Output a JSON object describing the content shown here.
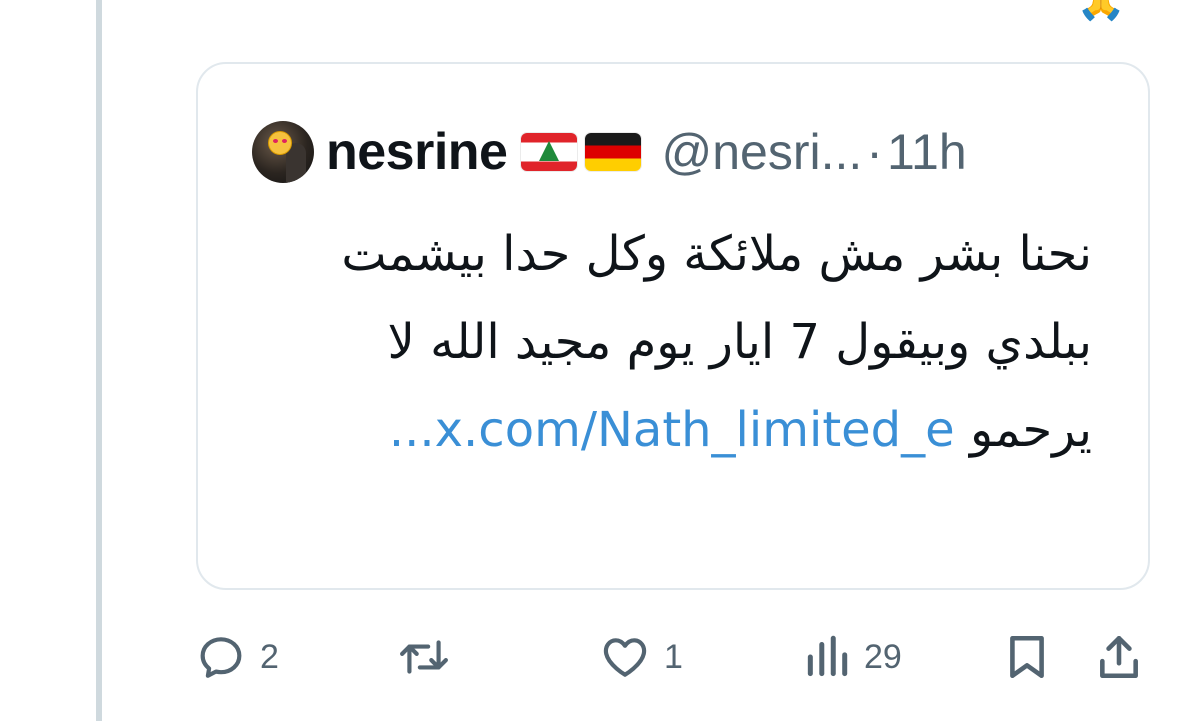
{
  "top": {
    "emoji": "🙏"
  },
  "quote": {
    "display_name": "nesrine",
    "flags": [
      "lebanon-flag",
      "germany-flag"
    ],
    "handle": "@nesri...",
    "separator": "·",
    "time": "11h",
    "text": "نحنا بشر مش ملائكة وكل حدا بيشمت ببلدي وبيقول 7 ايار يوم مجيد الله لا يرحمو",
    "link_text": "x.com/Nath_limited_e..."
  },
  "actions": {
    "replies": "2",
    "retweets": "",
    "likes": "1",
    "views": "29"
  },
  "colors": {
    "link": "#3a8fd6",
    "muted": "#536471",
    "border": "#e1e8ed",
    "thread_line": "#cfd9de"
  }
}
